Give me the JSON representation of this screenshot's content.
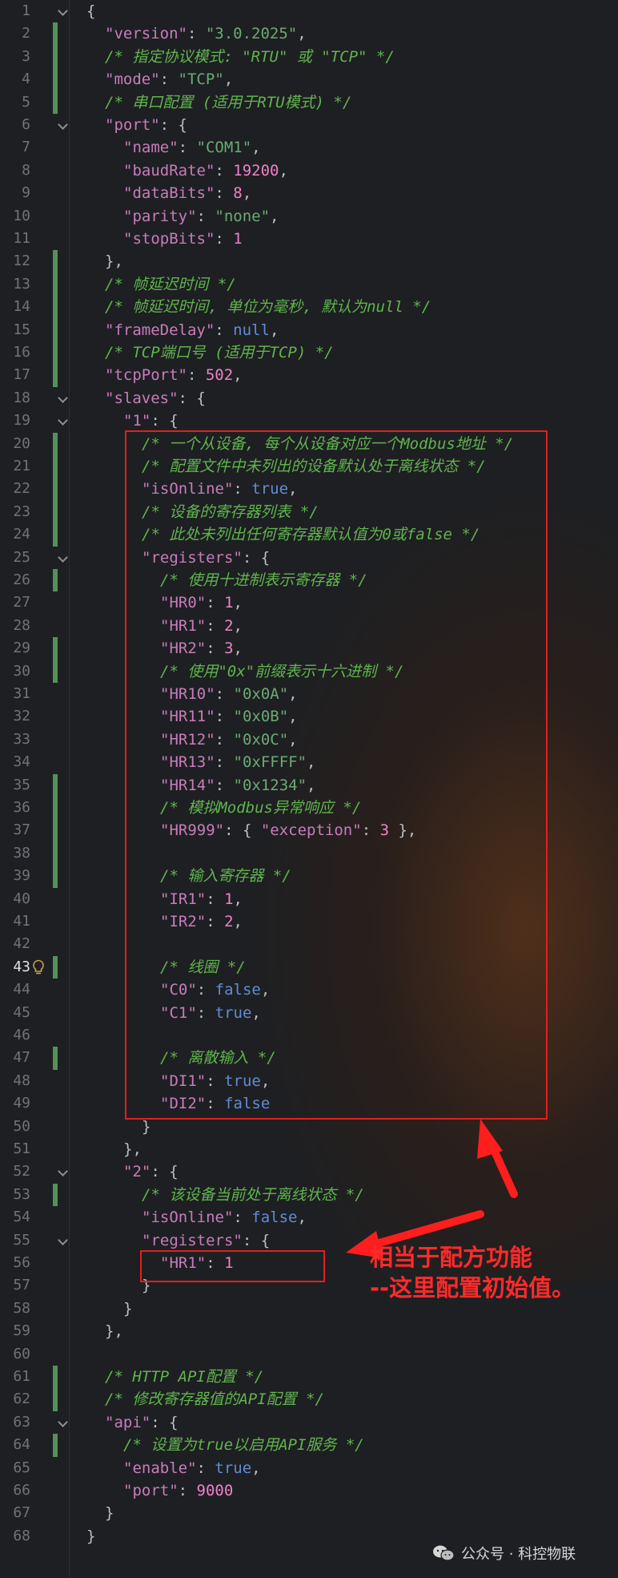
{
  "editor": {
    "active_line": 43,
    "lines": [
      {
        "n": "1",
        "indent": 0,
        "fold": true,
        "change": false,
        "t": [
          [
            "p",
            "{"
          ]
        ]
      },
      {
        "n": "2",
        "indent": 1,
        "fold": false,
        "change": true,
        "t": [
          [
            "k",
            "\"version\""
          ],
          [
            "p",
            ": "
          ],
          [
            "s",
            "\"3.0.2025\""
          ],
          [
            "p",
            ","
          ]
        ]
      },
      {
        "n": "3",
        "indent": 1,
        "fold": false,
        "change": true,
        "t": [
          [
            "c",
            "/* 指定协议模式: \"RTU\" 或 \"TCP\" */"
          ]
        ]
      },
      {
        "n": "4",
        "indent": 1,
        "fold": false,
        "change": true,
        "t": [
          [
            "k",
            "\"mode\""
          ],
          [
            "p",
            ": "
          ],
          [
            "s",
            "\"TCP\""
          ],
          [
            "p",
            ","
          ]
        ]
      },
      {
        "n": "5",
        "indent": 1,
        "fold": false,
        "change": true,
        "t": [
          [
            "c",
            "/* 串口配置 (适用于RTU模式) */"
          ]
        ]
      },
      {
        "n": "6",
        "indent": 1,
        "fold": true,
        "change": false,
        "t": [
          [
            "k",
            "\"port\""
          ],
          [
            "p",
            ": {"
          ]
        ]
      },
      {
        "n": "7",
        "indent": 2,
        "fold": false,
        "change": false,
        "t": [
          [
            "k",
            "\"name\""
          ],
          [
            "p",
            ": "
          ],
          [
            "s",
            "\"COM1\""
          ],
          [
            "p",
            ","
          ]
        ]
      },
      {
        "n": "8",
        "indent": 2,
        "fold": false,
        "change": false,
        "t": [
          [
            "k",
            "\"baudRate\""
          ],
          [
            "p",
            ": "
          ],
          [
            "n",
            "19200"
          ],
          [
            "p",
            ","
          ]
        ]
      },
      {
        "n": "9",
        "indent": 2,
        "fold": false,
        "change": false,
        "t": [
          [
            "k",
            "\"dataBits\""
          ],
          [
            "p",
            ": "
          ],
          [
            "n",
            "8"
          ],
          [
            "p",
            ","
          ]
        ]
      },
      {
        "n": "10",
        "indent": 2,
        "fold": false,
        "change": false,
        "t": [
          [
            "k",
            "\"parity\""
          ],
          [
            "p",
            ": "
          ],
          [
            "s",
            "\"none\""
          ],
          [
            "p",
            ","
          ]
        ]
      },
      {
        "n": "11",
        "indent": 2,
        "fold": false,
        "change": false,
        "t": [
          [
            "k",
            "\"stopBits\""
          ],
          [
            "p",
            ": "
          ],
          [
            "n",
            "1"
          ]
        ]
      },
      {
        "n": "12",
        "indent": 1,
        "fold": false,
        "change": true,
        "t": [
          [
            "p",
            "},"
          ]
        ]
      },
      {
        "n": "13",
        "indent": 1,
        "fold": false,
        "change": true,
        "t": [
          [
            "c",
            "/* 帧延迟时间 */"
          ]
        ]
      },
      {
        "n": "14",
        "indent": 1,
        "fold": false,
        "change": true,
        "t": [
          [
            "c",
            "/* 帧延迟时间, 单位为毫秒, 默认为null */"
          ]
        ]
      },
      {
        "n": "15",
        "indent": 1,
        "fold": false,
        "change": true,
        "t": [
          [
            "k",
            "\"frameDelay\""
          ],
          [
            "p",
            ": "
          ],
          [
            "kw",
            "null"
          ],
          [
            "p",
            ","
          ]
        ]
      },
      {
        "n": "16",
        "indent": 1,
        "fold": false,
        "change": true,
        "t": [
          [
            "c",
            "/* TCP端口号 (适用于TCP) */"
          ]
        ]
      },
      {
        "n": "17",
        "indent": 1,
        "fold": false,
        "change": true,
        "t": [
          [
            "k",
            "\"tcpPort\""
          ],
          [
            "p",
            ": "
          ],
          [
            "n",
            "502"
          ],
          [
            "p",
            ","
          ]
        ]
      },
      {
        "n": "18",
        "indent": 1,
        "fold": true,
        "change": false,
        "t": [
          [
            "k",
            "\"slaves\""
          ],
          [
            "p",
            ": {"
          ]
        ]
      },
      {
        "n": "19",
        "indent": 2,
        "fold": true,
        "change": false,
        "t": [
          [
            "k",
            "\"1\""
          ],
          [
            "p",
            ": {"
          ]
        ]
      },
      {
        "n": "20",
        "indent": 3,
        "fold": false,
        "change": true,
        "t": [
          [
            "c",
            "/* 一个从设备, 每个从设备对应一个Modbus地址 */"
          ]
        ]
      },
      {
        "n": "21",
        "indent": 3,
        "fold": false,
        "change": true,
        "t": [
          [
            "c",
            "/* 配置文件中未列出的设备默认处于离线状态 */"
          ]
        ]
      },
      {
        "n": "22",
        "indent": 3,
        "fold": false,
        "change": true,
        "t": [
          [
            "k",
            "\"isOnline\""
          ],
          [
            "p",
            ": "
          ],
          [
            "kw",
            "true"
          ],
          [
            "p",
            ","
          ]
        ]
      },
      {
        "n": "23",
        "indent": 3,
        "fold": false,
        "change": true,
        "t": [
          [
            "c",
            "/* 设备的寄存器列表 */"
          ]
        ]
      },
      {
        "n": "24",
        "indent": 3,
        "fold": false,
        "change": true,
        "t": [
          [
            "c",
            "/* 此处未列出任何寄存器默认值为0或false */"
          ]
        ]
      },
      {
        "n": "25",
        "indent": 3,
        "fold": true,
        "change": false,
        "t": [
          [
            "k",
            "\"registers\""
          ],
          [
            "p",
            ": {"
          ]
        ]
      },
      {
        "n": "26",
        "indent": 4,
        "fold": false,
        "change": true,
        "t": [
          [
            "c",
            "/* 使用十进制表示寄存器 */"
          ]
        ]
      },
      {
        "n": "27",
        "indent": 4,
        "fold": false,
        "change": false,
        "t": [
          [
            "k",
            "\"HR0\""
          ],
          [
            "p",
            ": "
          ],
          [
            "n",
            "1"
          ],
          [
            "p",
            ","
          ]
        ]
      },
      {
        "n": "28",
        "indent": 4,
        "fold": false,
        "change": false,
        "t": [
          [
            "k",
            "\"HR1\""
          ],
          [
            "p",
            ": "
          ],
          [
            "n",
            "2"
          ],
          [
            "p",
            ","
          ]
        ]
      },
      {
        "n": "29",
        "indent": 4,
        "fold": false,
        "change": true,
        "t": [
          [
            "k",
            "\"HR2\""
          ],
          [
            "p",
            ": "
          ],
          [
            "n",
            "3"
          ],
          [
            "p",
            ","
          ]
        ]
      },
      {
        "n": "30",
        "indent": 4,
        "fold": false,
        "change": true,
        "t": [
          [
            "c",
            "/* 使用\"0x\"前缀表示十六进制 */"
          ]
        ]
      },
      {
        "n": "31",
        "indent": 4,
        "fold": false,
        "change": false,
        "t": [
          [
            "k",
            "\"HR10\""
          ],
          [
            "p",
            ": "
          ],
          [
            "s",
            "\"0x0A\""
          ],
          [
            "p",
            ","
          ]
        ]
      },
      {
        "n": "32",
        "indent": 4,
        "fold": false,
        "change": false,
        "t": [
          [
            "k",
            "\"HR11\""
          ],
          [
            "p",
            ": "
          ],
          [
            "s",
            "\"0x0B\""
          ],
          [
            "p",
            ","
          ]
        ]
      },
      {
        "n": "33",
        "indent": 4,
        "fold": false,
        "change": false,
        "t": [
          [
            "k",
            "\"HR12\""
          ],
          [
            "p",
            ": "
          ],
          [
            "s",
            "\"0x0C\""
          ],
          [
            "p",
            ","
          ]
        ]
      },
      {
        "n": "34",
        "indent": 4,
        "fold": false,
        "change": false,
        "t": [
          [
            "k",
            "\"HR13\""
          ],
          [
            "p",
            ": "
          ],
          [
            "s",
            "\"0xFFFF\""
          ],
          [
            "p",
            ","
          ]
        ]
      },
      {
        "n": "35",
        "indent": 4,
        "fold": false,
        "change": true,
        "t": [
          [
            "k",
            "\"HR14\""
          ],
          [
            "p",
            ": "
          ],
          [
            "s",
            "\"0x1234\""
          ],
          [
            "p",
            ","
          ]
        ]
      },
      {
        "n": "36",
        "indent": 4,
        "fold": false,
        "change": true,
        "t": [
          [
            "c",
            "/* 模拟Modbus异常响应 */"
          ]
        ]
      },
      {
        "n": "37",
        "indent": 4,
        "fold": false,
        "change": true,
        "t": [
          [
            "k",
            "\"HR999\""
          ],
          [
            "p",
            ": { "
          ],
          [
            "k",
            "\"exception\""
          ],
          [
            "p",
            ": "
          ],
          [
            "n",
            "3"
          ],
          [
            "p",
            " },"
          ]
        ]
      },
      {
        "n": "38",
        "indent": 4,
        "fold": false,
        "change": true,
        "t": []
      },
      {
        "n": "39",
        "indent": 4,
        "fold": false,
        "change": true,
        "t": [
          [
            "c",
            "/* 输入寄存器 */"
          ]
        ]
      },
      {
        "n": "40",
        "indent": 4,
        "fold": false,
        "change": false,
        "t": [
          [
            "k",
            "\"IR1\""
          ],
          [
            "p",
            ": "
          ],
          [
            "n",
            "1"
          ],
          [
            "p",
            ","
          ]
        ]
      },
      {
        "n": "41",
        "indent": 4,
        "fold": false,
        "change": false,
        "t": [
          [
            "k",
            "\"IR2\""
          ],
          [
            "p",
            ": "
          ],
          [
            "n",
            "2"
          ],
          [
            "p",
            ","
          ]
        ]
      },
      {
        "n": "42",
        "indent": 4,
        "fold": false,
        "change": false,
        "t": []
      },
      {
        "n": "43",
        "indent": 4,
        "fold": false,
        "change": true,
        "bulb": true,
        "t": [
          [
            "c",
            "/* 线圈 */"
          ]
        ]
      },
      {
        "n": "44",
        "indent": 4,
        "fold": false,
        "change": false,
        "t": [
          [
            "k",
            "\"C0\""
          ],
          [
            "p",
            ": "
          ],
          [
            "kw",
            "false"
          ],
          [
            "p",
            ","
          ]
        ]
      },
      {
        "n": "45",
        "indent": 4,
        "fold": false,
        "change": false,
        "t": [
          [
            "k",
            "\"C1\""
          ],
          [
            "p",
            ": "
          ],
          [
            "kw",
            "true"
          ],
          [
            "p",
            ","
          ]
        ]
      },
      {
        "n": "46",
        "indent": 4,
        "fold": false,
        "change": false,
        "t": []
      },
      {
        "n": "47",
        "indent": 4,
        "fold": false,
        "change": true,
        "t": [
          [
            "c",
            "/* 离散输入 */"
          ]
        ]
      },
      {
        "n": "48",
        "indent": 4,
        "fold": false,
        "change": false,
        "t": [
          [
            "k",
            "\"DI1\""
          ],
          [
            "p",
            ": "
          ],
          [
            "kw",
            "true"
          ],
          [
            "p",
            ","
          ]
        ]
      },
      {
        "n": "49",
        "indent": 4,
        "fold": false,
        "change": false,
        "t": [
          [
            "k",
            "\"DI2\""
          ],
          [
            "p",
            ": "
          ],
          [
            "kw",
            "false"
          ]
        ]
      },
      {
        "n": "50",
        "indent": 3,
        "fold": false,
        "change": false,
        "t": [
          [
            "p",
            "}"
          ]
        ]
      },
      {
        "n": "51",
        "indent": 2,
        "fold": false,
        "change": false,
        "t": [
          [
            "p",
            "},"
          ]
        ]
      },
      {
        "n": "52",
        "indent": 2,
        "fold": true,
        "change": false,
        "t": [
          [
            "k",
            "\"2\""
          ],
          [
            "p",
            ": {"
          ]
        ]
      },
      {
        "n": "53",
        "indent": 3,
        "fold": false,
        "change": true,
        "t": [
          [
            "c",
            "/* 该设备当前处于离线状态 */"
          ]
        ]
      },
      {
        "n": "54",
        "indent": 3,
        "fold": false,
        "change": false,
        "t": [
          [
            "k",
            "\"isOnline\""
          ],
          [
            "p",
            ": "
          ],
          [
            "kw",
            "false"
          ],
          [
            "p",
            ","
          ]
        ]
      },
      {
        "n": "55",
        "indent": 3,
        "fold": true,
        "change": false,
        "t": [
          [
            "k",
            "\"registers\""
          ],
          [
            "p",
            ": {"
          ]
        ]
      },
      {
        "n": "56",
        "indent": 4,
        "fold": false,
        "change": false,
        "t": [
          [
            "k",
            "\"HR1\""
          ],
          [
            "p",
            ": "
          ],
          [
            "n",
            "1"
          ]
        ]
      },
      {
        "n": "57",
        "indent": 3,
        "fold": false,
        "change": false,
        "t": [
          [
            "p",
            "}"
          ]
        ]
      },
      {
        "n": "58",
        "indent": 2,
        "fold": false,
        "change": false,
        "t": [
          [
            "p",
            "}"
          ]
        ]
      },
      {
        "n": "59",
        "indent": 1,
        "fold": false,
        "change": false,
        "t": [
          [
            "p",
            "},"
          ]
        ]
      },
      {
        "n": "60",
        "indent": 1,
        "fold": false,
        "change": false,
        "t": []
      },
      {
        "n": "61",
        "indent": 1,
        "fold": false,
        "change": true,
        "t": [
          [
            "c",
            "/* HTTP API配置 */"
          ]
        ]
      },
      {
        "n": "62",
        "indent": 1,
        "fold": false,
        "change": true,
        "t": [
          [
            "c",
            "/* 修改寄存器值的API配置 */"
          ]
        ]
      },
      {
        "n": "63",
        "indent": 1,
        "fold": true,
        "change": false,
        "t": [
          [
            "k",
            "\"api\""
          ],
          [
            "p",
            ": {"
          ]
        ]
      },
      {
        "n": "64",
        "indent": 2,
        "fold": false,
        "change": true,
        "t": [
          [
            "c",
            "/* 设置为true以启用API服务 */"
          ]
        ]
      },
      {
        "n": "65",
        "indent": 2,
        "fold": false,
        "change": false,
        "t": [
          [
            "k",
            "\"enable\""
          ],
          [
            "p",
            ": "
          ],
          [
            "kw",
            "true"
          ],
          [
            "p",
            ","
          ]
        ]
      },
      {
        "n": "66",
        "indent": 2,
        "fold": false,
        "change": false,
        "t": [
          [
            "k",
            "\"port\""
          ],
          [
            "p",
            ": "
          ],
          [
            "n",
            "9000"
          ]
        ]
      },
      {
        "n": "67",
        "indent": 1,
        "fold": false,
        "change": false,
        "t": [
          [
            "p",
            "}"
          ]
        ]
      },
      {
        "n": "68",
        "indent": 0,
        "fold": false,
        "change": false,
        "t": [
          [
            "p",
            "}"
          ]
        ]
      }
    ]
  },
  "annotation": {
    "line1": "相当于配方功能",
    "line2": "--这里配置初始值。"
  },
  "watermark": {
    "text": "公众号 · 科控物联"
  },
  "colors": {
    "background": "#1e1f22",
    "key": "#c77dbb",
    "string": "#6aab73",
    "number": "#ee82c8",
    "keyword": "#5f8dd6",
    "comment": "#5fb44e",
    "annotation_red": "#e02020"
  },
  "icons": [
    "fold-chevron-icon",
    "lightbulb-icon",
    "wechat-icon",
    "red-arrow-icon"
  ]
}
